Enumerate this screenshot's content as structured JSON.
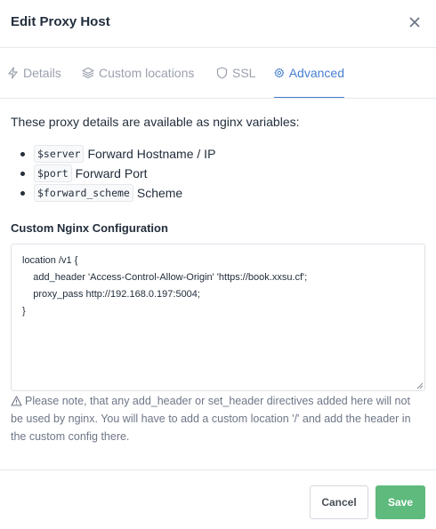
{
  "modal": {
    "title": "Edit Proxy Host"
  },
  "tabs": [
    {
      "label": "Details",
      "icon": "bolt-icon",
      "active": false
    },
    {
      "label": "Custom locations",
      "icon": "layers-icon",
      "active": false
    },
    {
      "label": "SSL",
      "icon": "shield-icon",
      "active": false
    },
    {
      "label": "Advanced",
      "icon": "gear-icon",
      "active": true
    }
  ],
  "advanced": {
    "intro": "These proxy details are available as nginx variables:",
    "variables": [
      {
        "code": "$server",
        "description": "Forward Hostname / IP"
      },
      {
        "code": "$port",
        "description": "Forward Port"
      },
      {
        "code": "$forward_scheme",
        "description": "Scheme"
      }
    ],
    "config_label": "Custom Nginx Configuration",
    "config_lines": [
      "location /v1 {",
      "    add_header 'Access-Control-Allow-Origin' 'https://book.xxsu.cf';",
      "    proxy_pass http://192.168.0.197:5004;",
      "}"
    ],
    "note": "Please note, that any add_header or set_header directives added here will not be used by nginx. You will have to add a custom location '/' and add the header in the custom config there."
  },
  "footer": {
    "cancel_label": "Cancel",
    "save_label": "Save"
  },
  "colors": {
    "accent": "#467fcf",
    "save": "#5eba7d",
    "text": "#232e3c",
    "muted": "#9aa0ac"
  }
}
